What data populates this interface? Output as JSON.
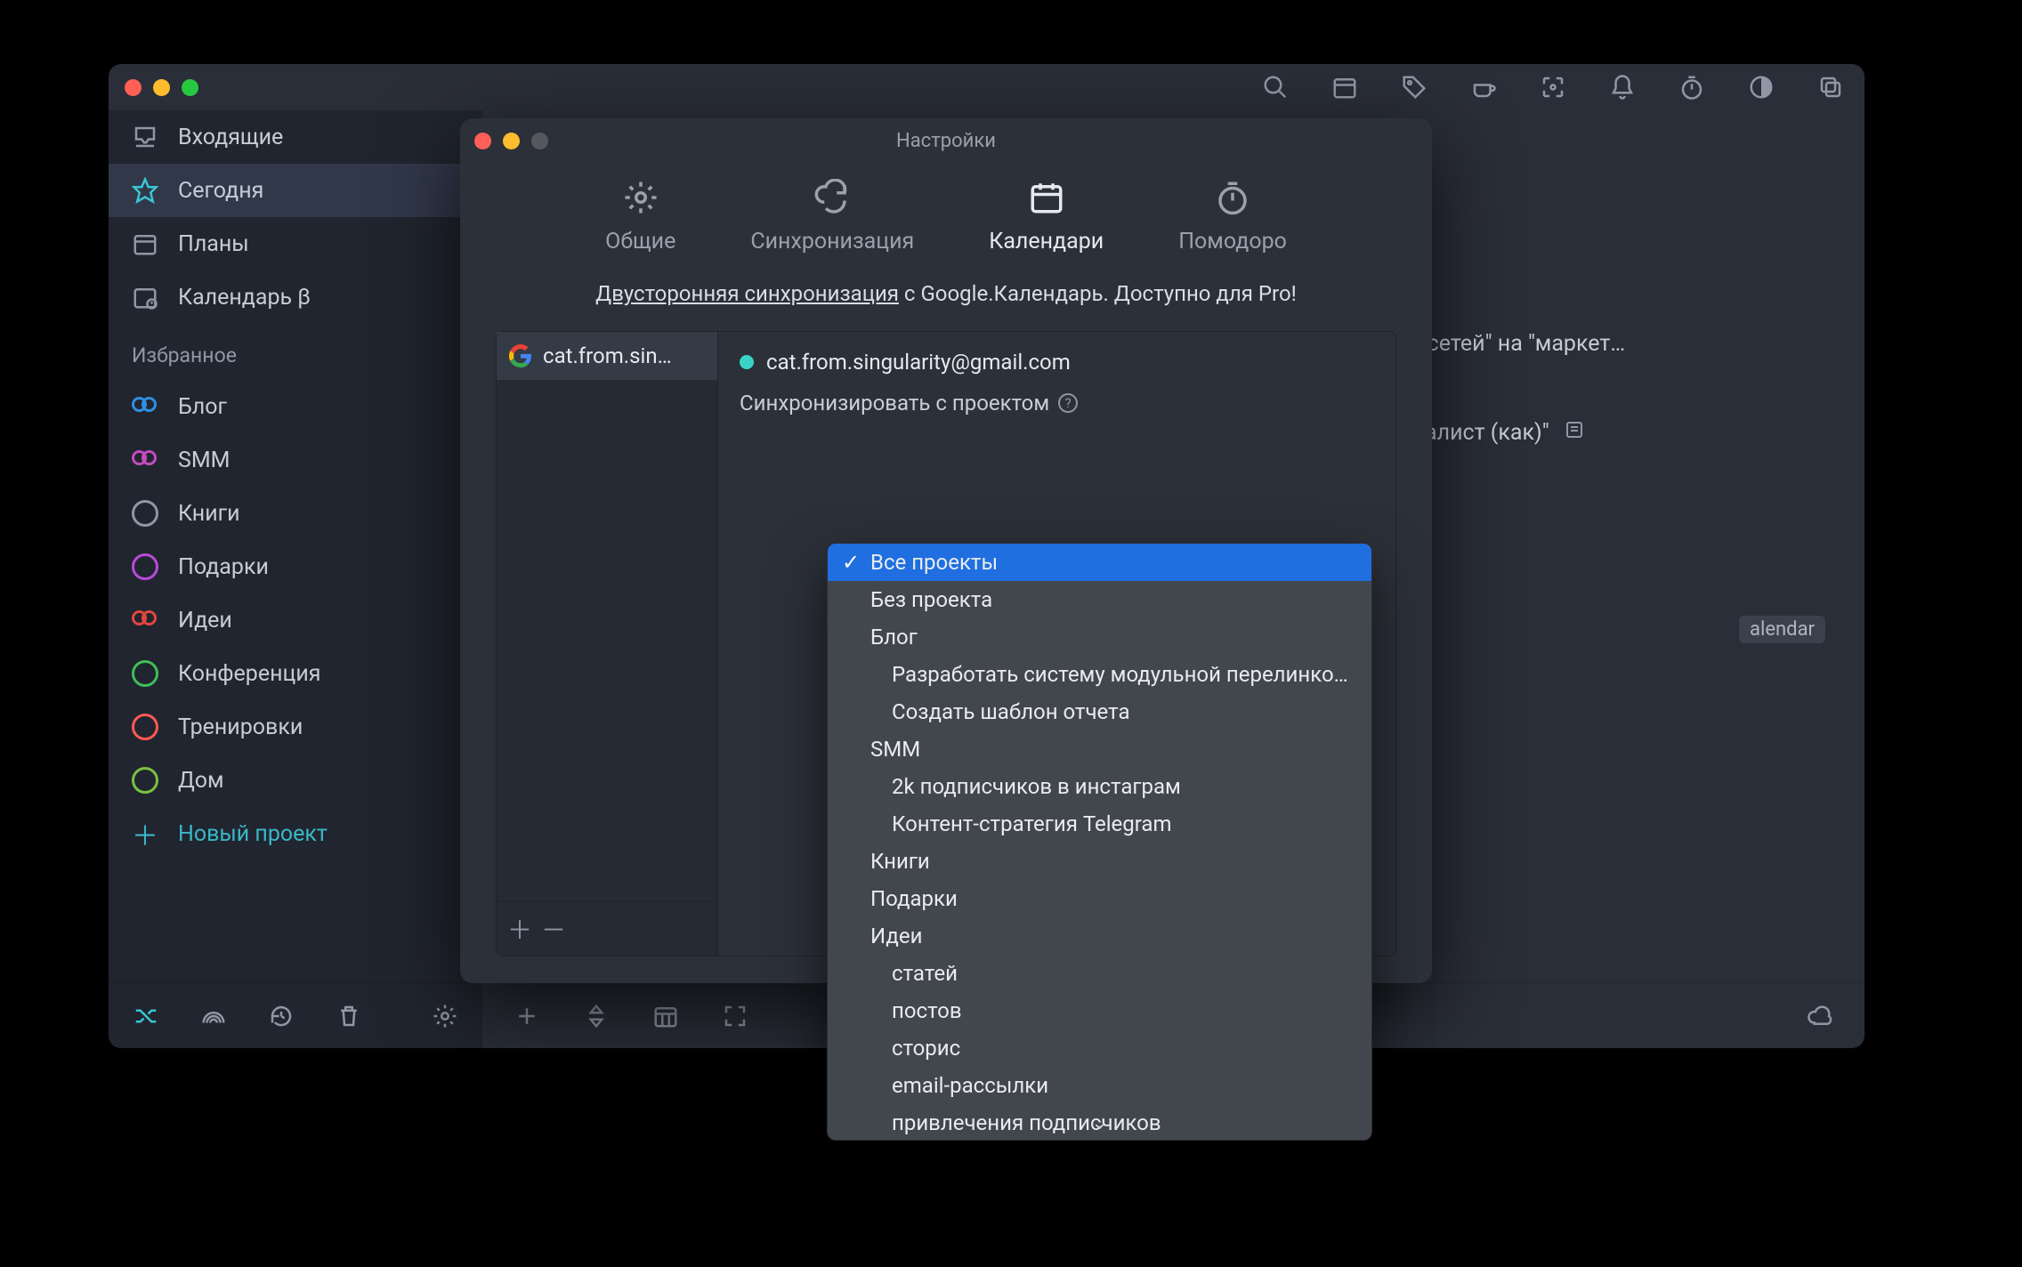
{
  "sidebar": {
    "nav": [
      {
        "label": "Входящие",
        "icon": "inbox-icon"
      },
      {
        "label": "Сегодня",
        "icon": "star-icon",
        "active": true
      },
      {
        "label": "Планы",
        "icon": "calendar-icon"
      },
      {
        "label": "Календарь β",
        "icon": "calendar-beta-icon"
      }
    ],
    "fav_header": "Избранное",
    "projects": [
      {
        "label": "Блог",
        "color": "#2f8fe3",
        "shape": "infinity"
      },
      {
        "label": "SMM",
        "color": "#c64bc0",
        "shape": "infinity"
      },
      {
        "label": "Книги",
        "color": "#8f97a6",
        "shape": "ring"
      },
      {
        "label": "Подарки",
        "color": "#b84bd8",
        "shape": "ring"
      },
      {
        "label": "Идеи",
        "color": "#e0473f",
        "shape": "infinity"
      },
      {
        "label": "Конференция",
        "color": "#3fbf57",
        "shape": "ring"
      },
      {
        "label": "Тренировки",
        "color": "#ff5a52",
        "shape": "ring"
      },
      {
        "label": "Дом",
        "color": "#7ac23f",
        "shape": "ring"
      }
    ],
    "new_project_label": "Новый проект"
  },
  "main": {
    "task_snippets": [
      "с \"Соцсетей\" на \"маркет…",
      "специалист (как)\""
    ],
    "calendar_badge": "alendar"
  },
  "settings": {
    "title": "Настройки",
    "tabs": {
      "general": "Общие",
      "sync": "Синхронизация",
      "calendars": "Календари",
      "pomodoro": "Помодоро"
    },
    "banner_link": "Двусторонняя синхронизация",
    "banner_rest": " с Google.Календарь. Доступно для Pro!",
    "account_short": "cat.from.sin…",
    "account_full": "cat.from.singularity@gmail.com",
    "sync_label": "Синхронизировать с проектом"
  },
  "dropdown": {
    "items": [
      {
        "label": "Все проекты",
        "selected": true
      },
      {
        "label": "Без проекта"
      },
      {
        "label": "Блог"
      },
      {
        "label": "Разработать систему модульной перелинков…",
        "indent": 1
      },
      {
        "label": "Создать шаблон отчета",
        "indent": 1
      },
      {
        "label": "SMM"
      },
      {
        "label": "2k подписчиков в инстаграм",
        "indent": 1
      },
      {
        "label": "Контент-стратегия Telegram",
        "indent": 1
      },
      {
        "label": "Книги"
      },
      {
        "label": "Подарки"
      },
      {
        "label": "Идеи"
      },
      {
        "label": "статей",
        "indent": 1
      },
      {
        "label": "постов",
        "indent": 1
      },
      {
        "label": "сторис",
        "indent": 1
      },
      {
        "label": "email-рассылки",
        "indent": 1
      },
      {
        "label": "привлечения подписчиков",
        "indent": 1
      }
    ]
  }
}
